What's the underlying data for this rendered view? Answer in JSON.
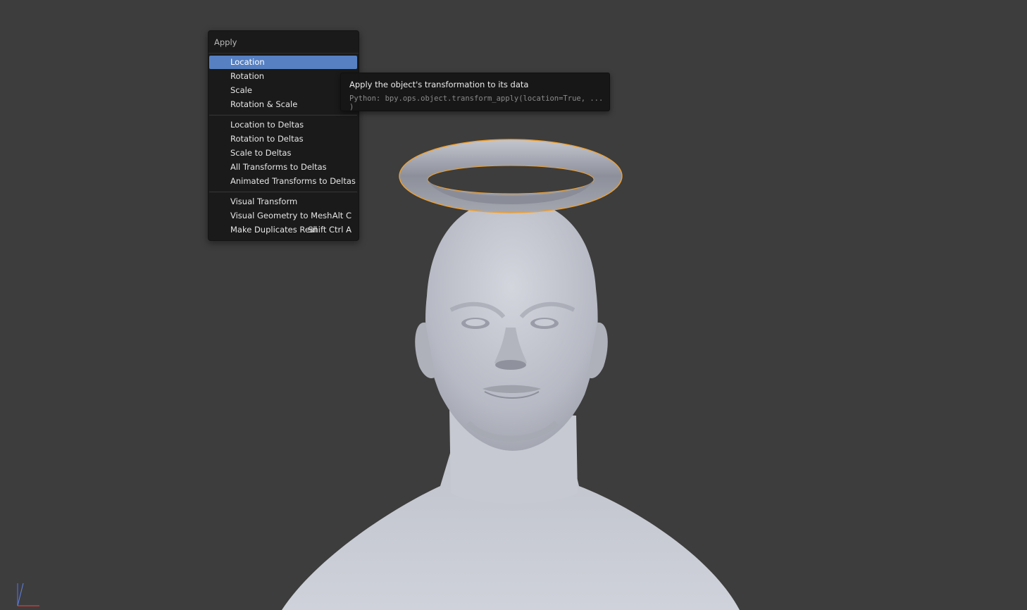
{
  "menu": {
    "title": "Apply",
    "items": [
      {
        "label": "Location",
        "shortcut": "",
        "active": true
      },
      {
        "label": "Rotation",
        "shortcut": ""
      },
      {
        "label": "Scale",
        "shortcut": ""
      },
      {
        "label": "Rotation & Scale",
        "shortcut": ""
      },
      {
        "label": "Location to Deltas",
        "shortcut": ""
      },
      {
        "label": "Rotation to Deltas",
        "shortcut": ""
      },
      {
        "label": "Scale to Deltas",
        "shortcut": ""
      },
      {
        "label": "All Transforms to Deltas",
        "shortcut": ""
      },
      {
        "label": "Animated Transforms to Deltas",
        "shortcut": ""
      },
      {
        "label": "Visual Transform",
        "shortcut": ""
      },
      {
        "label": "Visual Geometry to Mesh",
        "shortcut": "Alt C"
      },
      {
        "label": "Make Duplicates Real",
        "shortcut": "Shift Ctrl A"
      }
    ]
  },
  "tooltip": {
    "title": "Apply the object's transformation to its data",
    "python": "Python: bpy.ops.object.transform_apply(location=True, ... )"
  },
  "viewport": {
    "background_color": "#3d3d3d",
    "selection_outline_color": "#f0a030",
    "highlight_color": "#5680c2",
    "objects": [
      "head-mesh",
      "halo-torus"
    ]
  }
}
